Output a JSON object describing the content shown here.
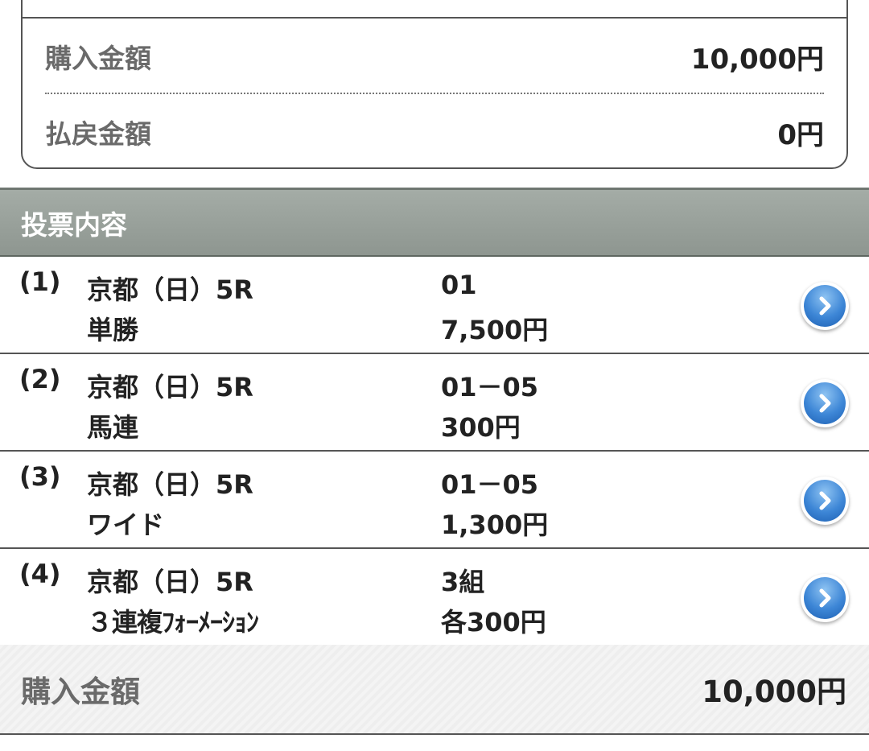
{
  "summary": {
    "purchase_label": "購入金額",
    "purchase_value": "10,000円",
    "payout_label": "払戻金額",
    "payout_value": "0円"
  },
  "section": {
    "title": "投票内容"
  },
  "bets": [
    {
      "index": "(1)",
      "venue": "京都（日）5R",
      "type": "単勝",
      "combo": "01",
      "amount": "7,500円"
    },
    {
      "index": "(2)",
      "venue": "京都（日）5R",
      "type": "馬連",
      "combo": "01－05",
      "amount": "300円"
    },
    {
      "index": "(3)",
      "venue": "京都（日）5R",
      "type": "ワイド",
      "combo": "01－05",
      "amount": "1,300円"
    },
    {
      "index": "(4)",
      "venue": "京都（日）5R",
      "type": "３連複ﾌｫｰﾒｰｼｮﾝ",
      "combo": "3組",
      "amount": "各300円"
    }
  ],
  "total": {
    "label": "購入金額",
    "value": "10,000円"
  },
  "icons": {
    "detail": "chevron-right-circle-icon"
  },
  "colors": {
    "header_bg": "#979f99",
    "chevron_blue": "#3d86d6",
    "label_gray": "#6a6a6a"
  }
}
